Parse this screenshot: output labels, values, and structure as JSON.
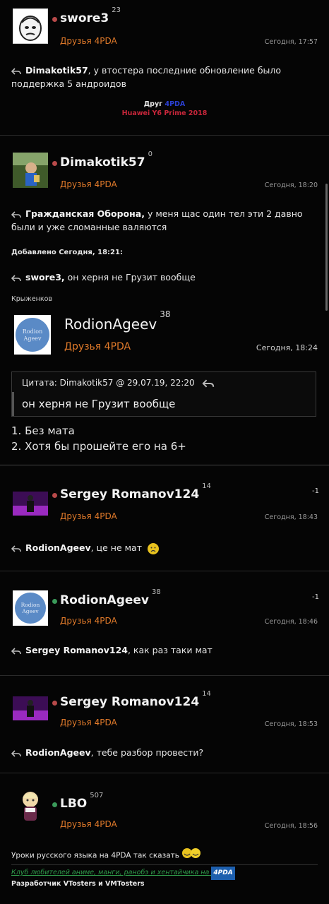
{
  "posts": [
    {
      "nick": "swore3",
      "rep": "23",
      "group": "Друзья 4PDA",
      "time": "Сегодня, 17:57",
      "reply_to": "Dimakotik57",
      "text_line1": ", у втостера последние обновление было",
      "text_line2": "поддержка 5 андроидов",
      "sig_line1_a": "Друг",
      "sig_line1_b": "4PDA",
      "sig_line2": "Huawei Y6 Prime 2018"
    },
    {
      "nick": "Dimakotik57",
      "rep": "0",
      "group": "Друзья 4PDA",
      "time": "Сегодня, 18:20",
      "reply_to": "Гражданская Оборона,",
      "text_line1": " у меня щас один тел эти 2 давно",
      "text_line2": "были и уже сломанные валяются",
      "added_label": "Добавлено Сегодня, 18:21:",
      "reply2_to": "swore3,",
      "reply2_text": " он херня не Грузит вообще",
      "sig": "Крыженков"
    },
    {
      "nick": "RodionAgeev",
      "rep": "38",
      "group": "Друзья 4PDA",
      "time": "Сегодня, 18:24",
      "avatar_text1": "Rodion",
      "avatar_text2": "Ageev",
      "quote_head": "Цитата: Dimakotik57 @ 29.07.19, 22:20",
      "quote_text": "он херня не Грузит вообще",
      "list1": "1. Без мата",
      "list2": "2. Хотя бы прошейте его на 6+"
    },
    {
      "nick": "Sergey Romanov124",
      "rep": "14",
      "group": "Друзья 4PDA",
      "time": "Сегодня, 18:43",
      "score": "-1",
      "reply_to": "RodionAgeev",
      "text": ", це не мат"
    },
    {
      "nick": "RodionAgeev",
      "rep": "38",
      "group": "Друзья 4PDA",
      "time": "Сегодня, 18:46",
      "score": "-1",
      "avatar_text1": "Rodion",
      "avatar_text2": "Ageev",
      "reply_to": "Sergey Romanov124",
      "text": ", как раз таки мат"
    },
    {
      "nick": "Sergey Romanov124",
      "rep": "14",
      "group": "Друзья 4PDA",
      "time": "Сегодня, 18:53",
      "reply_to": "RodionAgeev",
      "text": ", тебе разбор провести?"
    },
    {
      "nick": "LBO",
      "rep": "507",
      "group": "Друзья 4PDA",
      "time": "Сегодня, 18:56",
      "text": "Уроки русского языка на 4PDA так сказать",
      "sig_link": "Клуб любителей аниме, манги, ранобэ и хентайчика на",
      "sig_logo": "4PDA",
      "sig_dev": "Разработчик VTosters и VMTosters"
    }
  ],
  "colors": {
    "accent": "#e07a2a",
    "sig_blue": "#2a3fd0",
    "sig_red": "#c8263a",
    "link_green": "#2f9a4a"
  }
}
